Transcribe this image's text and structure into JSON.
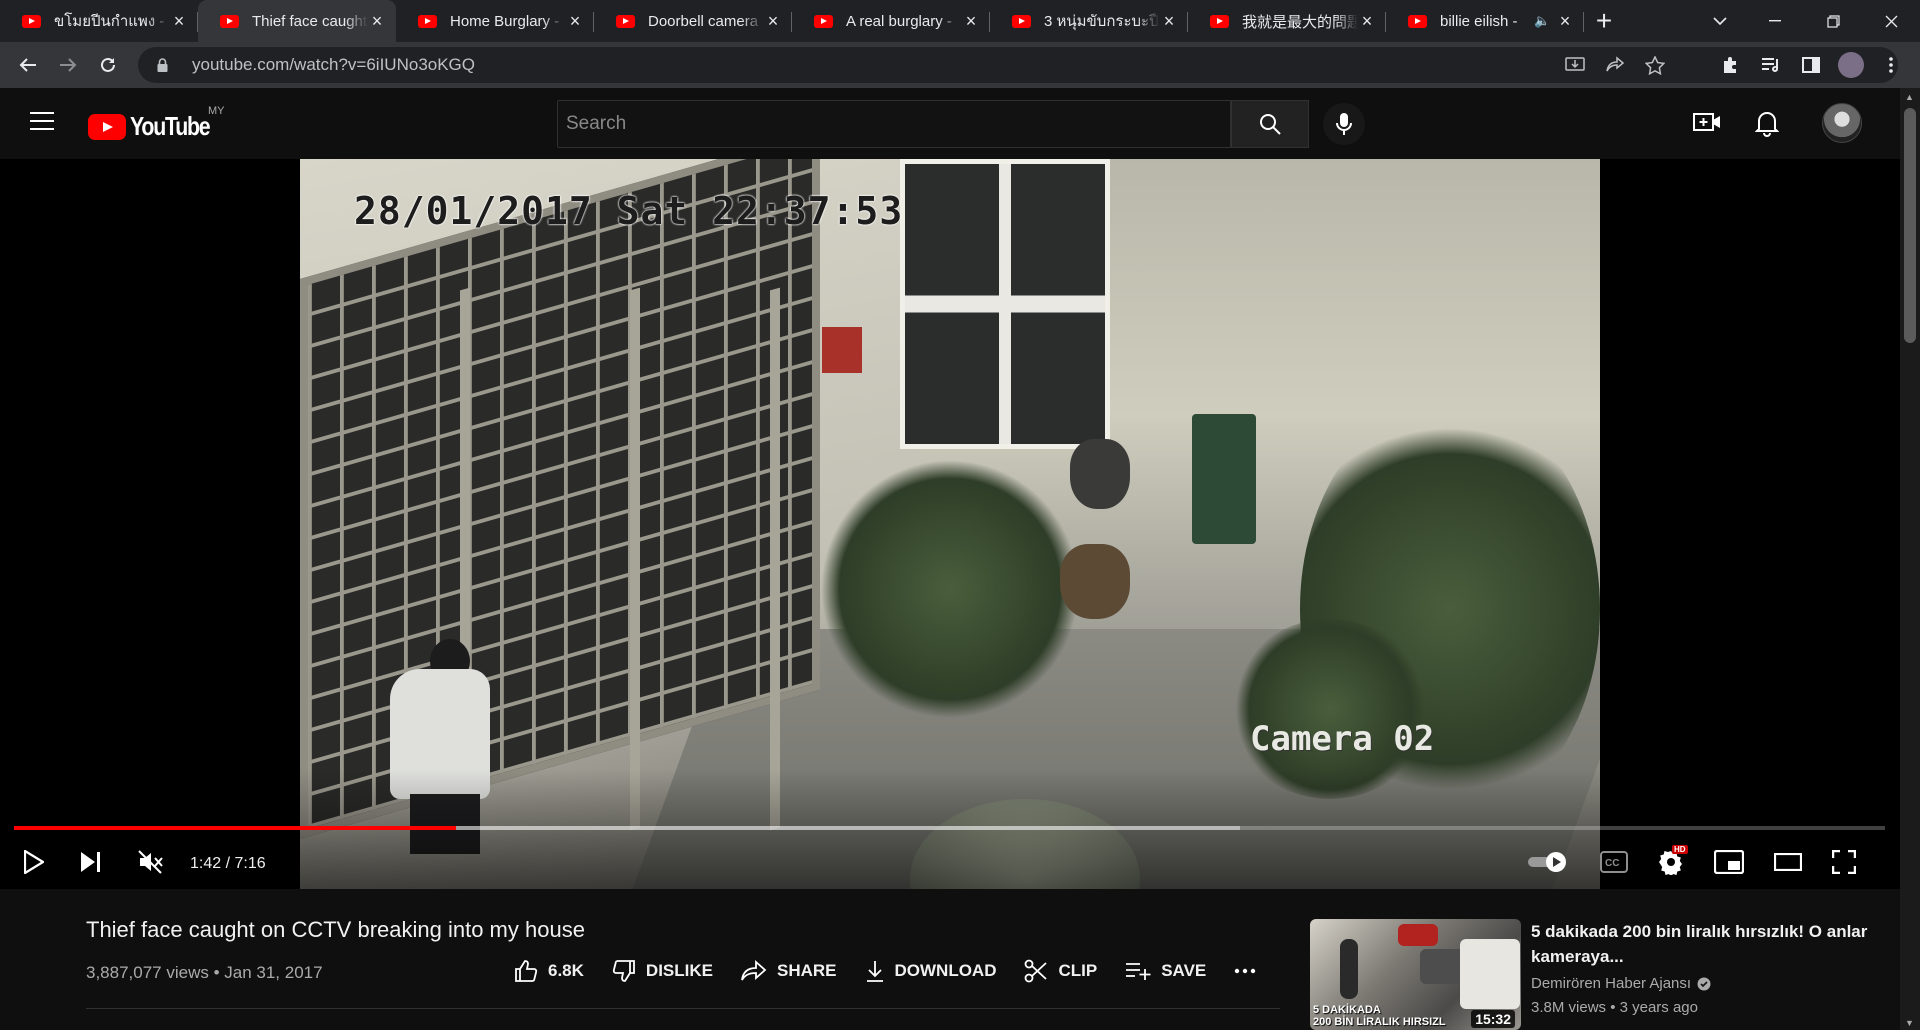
{
  "browser": {
    "tabs": [
      {
        "title": "ขโมยปีนกำแพง - Yo",
        "active": false
      },
      {
        "title": "Thief face caught",
        "active": true
      },
      {
        "title": "Home Burglary - ",
        "active": false
      },
      {
        "title": "Doorbell camera ",
        "active": false
      },
      {
        "title": "A real burglary - ",
        "active": false
      },
      {
        "title": "3 หนุ่มขับกระบะปืนเ",
        "active": false
      },
      {
        "title": "我就是最大的問題",
        "active": false
      },
      {
        "title": "billie eilish - ",
        "active": false,
        "audio": true
      }
    ],
    "new_tab_label": "+",
    "url": "youtube.com/watch?v=6iIUNo3oKGQ"
  },
  "youtube": {
    "logo_text": "YouTube",
    "region": "MY",
    "search_placeholder": "Search"
  },
  "video": {
    "osd_timestamp": "28/01/2017 Sat 22:37:53",
    "osd_camera": "Camera 02",
    "time_display": "1:42 / 7:16",
    "progress_played": 0.236,
    "progress_buffered": 0.655,
    "quality_badge": "HD",
    "title": "Thief face caught on CCTV breaking into my house",
    "meta": "3,887,077 views • Jan 31, 2017"
  },
  "actions": {
    "like": "6.8K",
    "dislike": "DISLIKE",
    "share": "SHARE",
    "download": "DOWNLOAD",
    "clip": "CLIP",
    "save": "SAVE"
  },
  "recommendation": {
    "title": "5 dakikada 200 bin liralık hırsızlık! O anlar kameraya...",
    "channel": "Demirören Haber Ajansı",
    "stats": "3.8M views • 3 years ago",
    "duration": "15:32",
    "thumb_text_1": "5 DAKİKADA",
    "thumb_text_2": "200 BİN LİRALIK HIRSIZL"
  },
  "colors": {
    "accent": "#ff0000",
    "background": "#0f0f0f",
    "tab_strip": "#202124",
    "toolbar": "#35363a"
  }
}
